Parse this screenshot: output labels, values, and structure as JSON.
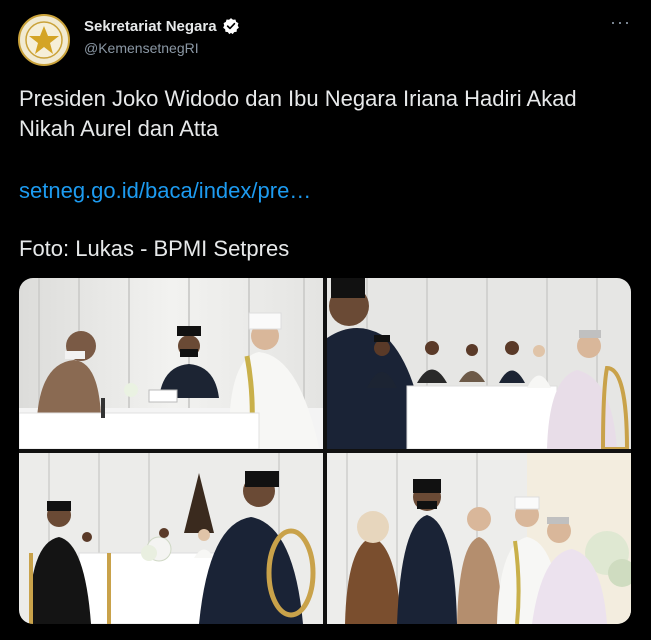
{
  "account": {
    "display_name": "Sekretariat Negara",
    "handle": "@KemensetnegRI",
    "verified": true,
    "avatar_icon": "gold-star-emblem-icon"
  },
  "tweet": {
    "text": "Presiden Joko Widodo dan Ibu Negara Iriana Hadiri Akad Nikah Aurel dan Atta",
    "link": "setneg.go.id/baca/index/pre…",
    "credit": "Foto: Lukas - BPMI Setpres",
    "more_icon": "more-options-icon"
  },
  "photos": [
    {
      "name": "photo-1"
    },
    {
      "name": "photo-2"
    },
    {
      "name": "photo-3"
    },
    {
      "name": "photo-4"
    }
  ],
  "colors": {
    "background": "#000000",
    "text": "#e7e9ea",
    "secondary_text": "#8b98a5",
    "link": "#1d9bf0"
  }
}
